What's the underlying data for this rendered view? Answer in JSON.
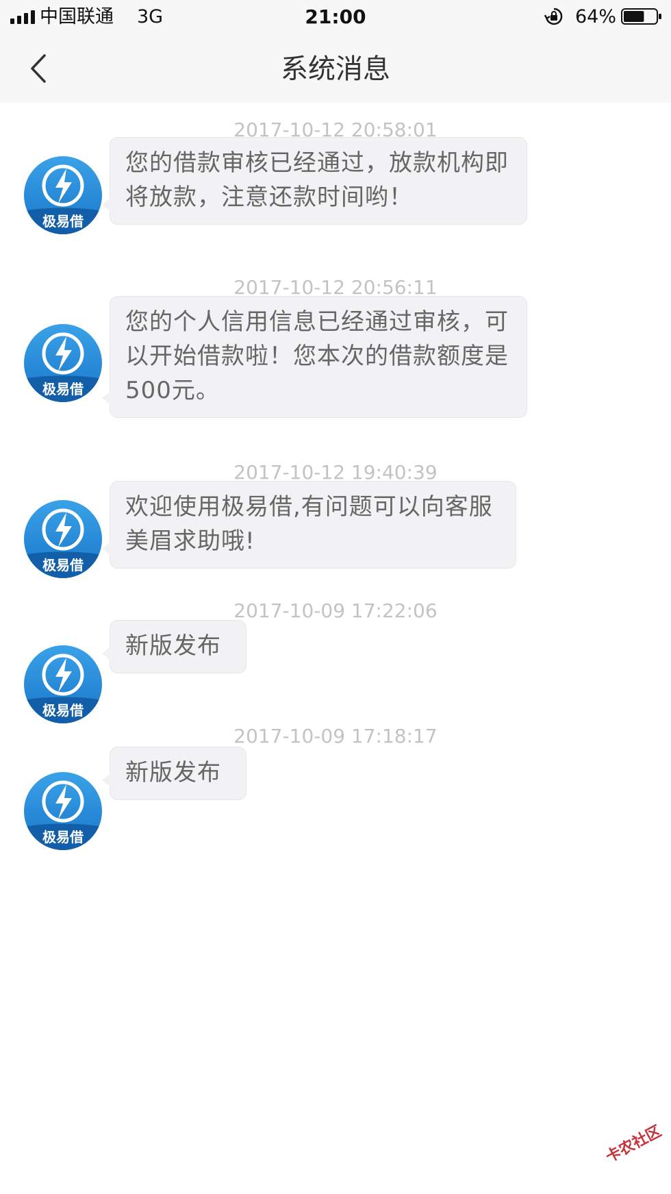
{
  "status_bar": {
    "carrier": "中国联通",
    "network": "3G",
    "time": "21:00",
    "battery_percent": "64%",
    "battery_level": 0.64
  },
  "nav": {
    "title": "系统消息",
    "back_icon": "chevron-left-icon"
  },
  "messages": [
    {
      "timestamp": "2017-10-12 20:58:01",
      "text": "您的借款审核已经通过，放款机构即将放款，注意还款时间哟！",
      "avatar_label": "极易借"
    },
    {
      "timestamp": "2017-10-12 20:56:11",
      "text": "您的个人信用信息已经通过审核，可以开始借款啦！您本次的借款额度是500元。",
      "avatar_label": "极易借"
    },
    {
      "timestamp": "2017-10-12 19:40:39",
      "text": "欢迎使用极易借,有问题可以向客服美眉求助哦!",
      "avatar_label": "极易借"
    },
    {
      "timestamp": "2017-10-09 17:22:06",
      "text": "新版发布",
      "avatar_label": "极易借"
    },
    {
      "timestamp": "2017-10-09 17:18:17",
      "text": "新版发布",
      "avatar_label": "极易借"
    }
  ],
  "watermark": {
    "text": "卡农社区"
  },
  "colors": {
    "avatar_blue": "#1f86d6",
    "bubble_bg": "#f2f2f4",
    "timestamp": "#c3c3c3",
    "watermark_red": "#c8323a"
  }
}
